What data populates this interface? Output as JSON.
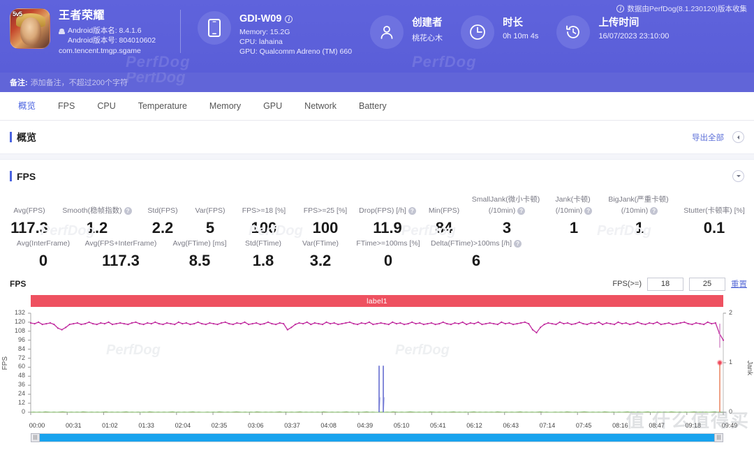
{
  "header": {
    "game": {
      "title": "王者荣耀",
      "version_name": "Android版本名: 8.4.1.6",
      "version_code": "Android版本号: 804010602",
      "package": "com.tencent.tmgp.sgame",
      "icon_badge": "5v5",
      "android_icon": "android-icon"
    },
    "device": {
      "name": "GDI-W09",
      "memory": "Memory: 15.2G",
      "cpu": "CPU: lahaina",
      "gpu": "GPU: Qualcomm Adreno (TM) 660",
      "icon": "phone-icon",
      "info_icon": "info-icon"
    },
    "creator": {
      "title": "创建者",
      "value": "桃花心木",
      "icon": "user-icon"
    },
    "duration": {
      "title": "时长",
      "value": "0h 10m 4s",
      "icon": "clock-icon"
    },
    "upload": {
      "title": "上传时间",
      "value": "16/07/2023 23:10:00",
      "icon": "history-icon"
    },
    "collect_note": "数据由PerfDog(8.1.230120)版本收集",
    "watermark": "PerfDog"
  },
  "note_bar": {
    "label": "备注:",
    "placeholder": "添加备注，不超过200个字符"
  },
  "tabs": [
    {
      "label": "概览",
      "active": true
    },
    {
      "label": "FPS",
      "active": false
    },
    {
      "label": "CPU",
      "active": false
    },
    {
      "label": "Temperature",
      "active": false
    },
    {
      "label": "Memory",
      "active": false
    },
    {
      "label": "GPU",
      "active": false
    },
    {
      "label": "Network",
      "active": false
    },
    {
      "label": "Battery",
      "active": false
    }
  ],
  "overview_section": {
    "title": "概览",
    "export_label": "导出全部",
    "collapse_icon": "chevron-left-icon"
  },
  "fps_section": {
    "title": "FPS",
    "collapse_icon": "chevron-down-icon"
  },
  "metrics_row1": [
    {
      "label": "Avg(FPS)",
      "value": "117.3",
      "help": false
    },
    {
      "label": "Smooth(稳帧指数)",
      "value": "1.2",
      "help": true
    },
    {
      "label": "Std(FPS)",
      "value": "2.2",
      "help": false
    },
    {
      "label": "Var(FPS)",
      "value": "5",
      "help": false
    },
    {
      "label": "FPS>=18 [%]",
      "value": "100",
      "help": false
    },
    {
      "label": "FPS>=25 [%]",
      "value": "100",
      "help": false
    },
    {
      "label": "Drop(FPS) [/h]",
      "value": "11.9",
      "help": true
    },
    {
      "label": "Min(FPS)",
      "value": "84",
      "help": false
    },
    {
      "label": "SmallJank(微小卡顿)\n(/10min)",
      "value": "3",
      "help": true
    },
    {
      "label": "Jank(卡顿)\n(/10min)",
      "value": "1",
      "help": true
    },
    {
      "label": "BigJank(严重卡顿)\n(/10min)",
      "value": "1",
      "help": true
    },
    {
      "label": "Stutter(卡顿率) [%]",
      "value": "0.1",
      "help": false
    }
  ],
  "metrics_row2": [
    {
      "label": "Avg(InterFrame)",
      "value": "0",
      "help": false
    },
    {
      "label": "Avg(FPS+InterFrame)",
      "value": "117.3",
      "help": false
    },
    {
      "label": "Avg(FTime) [ms]",
      "value": "8.5",
      "help": false
    },
    {
      "label": "Std(FTime)",
      "value": "1.8",
      "help": false
    },
    {
      "label": "Var(FTime)",
      "value": "3.2",
      "help": false
    },
    {
      "label": "FTime>=100ms [%]",
      "value": "0",
      "help": false
    },
    {
      "label": "Delta(FTime)>100ms [/h]",
      "value": "6",
      "help": true
    }
  ],
  "chart_controls": {
    "title": "FPS",
    "threshold_label": "FPS(>=)",
    "threshold_low": "18",
    "threshold_high": "25",
    "reset_label": "重置",
    "series_label": "label1"
  },
  "chart_data": {
    "type": "line",
    "title": "FPS",
    "xlabel": "",
    "ylabel": "FPS",
    "y2label": "Jank",
    "ylim": [
      0,
      132
    ],
    "y2lim": [
      0,
      2
    ],
    "grid": false,
    "legend": "none",
    "yticks": [
      0,
      12,
      24,
      36,
      48,
      60,
      72,
      84,
      96,
      108,
      120,
      132
    ],
    "y2ticks": [
      0,
      1,
      2
    ],
    "xticks": [
      "00:00",
      "00:31",
      "01:02",
      "01:33",
      "02:04",
      "02:35",
      "03:06",
      "03:37",
      "04:08",
      "04:39",
      "05:10",
      "05:41",
      "06:12",
      "06:43",
      "07:14",
      "07:45",
      "08:16",
      "08:47",
      "09:18",
      "09:49"
    ],
    "series": [
      {
        "name": "FPS",
        "color": "#c0299e",
        "axis": "left",
        "note": "Dense per-second FPS trace hovering near 117-120 with occasional dips toward 108-112 and one deep dip near the end.",
        "values": [
          119,
          118,
          120,
          117,
          118,
          119,
          117,
          112,
          110,
          113,
          117,
          118,
          119,
          117,
          118,
          120,
          118,
          117,
          119,
          118,
          120,
          117,
          118,
          119,
          118,
          117,
          119,
          120,
          118,
          117,
          119,
          118,
          120,
          118,
          117,
          119,
          118,
          117,
          120,
          118,
          119,
          117,
          118,
          120,
          118,
          117,
          119,
          118,
          117,
          119,
          120,
          118,
          117,
          119,
          118,
          120,
          117,
          118,
          119,
          117,
          118,
          120,
          118,
          117,
          119,
          118,
          110,
          113,
          117,
          119,
          118,
          120,
          117,
          119,
          118,
          117,
          120,
          118,
          119,
          117,
          118,
          119,
          120,
          118,
          117,
          119,
          118,
          120,
          117,
          118,
          119,
          118,
          117,
          120,
          118,
          119,
          117,
          118,
          120,
          118,
          119,
          117,
          118,
          119,
          117,
          118,
          120,
          118,
          117,
          119,
          118,
          120,
          117,
          119,
          118,
          120,
          117,
          118,
          119,
          118,
          117,
          120,
          118,
          119,
          117,
          118,
          119,
          120,
          118,
          110,
          106,
          113,
          117,
          119,
          118,
          117,
          120,
          118,
          119,
          117,
          118,
          120,
          118,
          117,
          119,
          118,
          120,
          117,
          119,
          118,
          117,
          120,
          118,
          119,
          117,
          118,
          120,
          118,
          117,
          119,
          118,
          120,
          117,
          118,
          119,
          117,
          118,
          119,
          120,
          118,
          117,
          119,
          118,
          117,
          120,
          118,
          119,
          105,
          96
        ]
      },
      {
        "name": "Jank",
        "color": "#ee5160",
        "axis": "right",
        "note": "Single Jank marker at value 1 near the very end of the timeline.",
        "points": [
          {
            "x": "09:45",
            "y": 1
          }
        ]
      },
      {
        "name": "FTime/Delta spikes",
        "color": "#5b5fd6",
        "axis": "left",
        "note": "Two tall narrow blue spikes reaching ~62 around 05:10.",
        "points": [
          {
            "x": "05:07",
            "y": 62
          },
          {
            "x": "05:12",
            "y": 62
          }
        ]
      },
      {
        "name": "Baseline",
        "color": "#7bbf6a",
        "axis": "left",
        "note": "Flat green trace along the zero baseline for the whole timeline.",
        "values": [
          0,
          1,
          0,
          1,
          0,
          2,
          1,
          0,
          1,
          0,
          1,
          2,
          1,
          0,
          1,
          0,
          1,
          0,
          2,
          1,
          0,
          1,
          0,
          1,
          0,
          1,
          2,
          0,
          1,
          0,
          1,
          0,
          1,
          2,
          0,
          1,
          0,
          1,
          0,
          1,
          0,
          2,
          1,
          0,
          1,
          0,
          1,
          0,
          1,
          2,
          0,
          1,
          0,
          1,
          0,
          1,
          2,
          0,
          1,
          0
        ]
      }
    ]
  },
  "bottom_scrollbar": {
    "handle_icon": "drag-handle-icon"
  },
  "page_watermark": "值 什么值得买"
}
